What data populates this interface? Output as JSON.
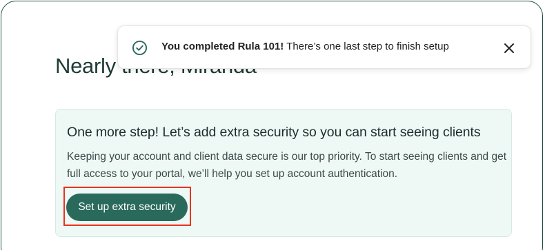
{
  "header": {
    "title": "Nearly there, Miranda"
  },
  "toast": {
    "bold_text": "You completed Rula 101!",
    "message": " There’s one last step to finish setup",
    "status_icon": "check-circle-icon",
    "close_icon": "close-icon"
  },
  "security_card": {
    "heading": "One more step! Let’s add extra security so you can start seeing clients",
    "body": "Keeping your account and client data secure is our top priority. To start seeing clients and get full access to your portal, we’ll help you set up account authentication.",
    "button_label": "Set up extra security"
  },
  "colors": {
    "brand_green": "#2a6a5c",
    "card_background": "#eef8f5",
    "highlight_red": "#e8331c",
    "title_color": "#1e3b36"
  }
}
